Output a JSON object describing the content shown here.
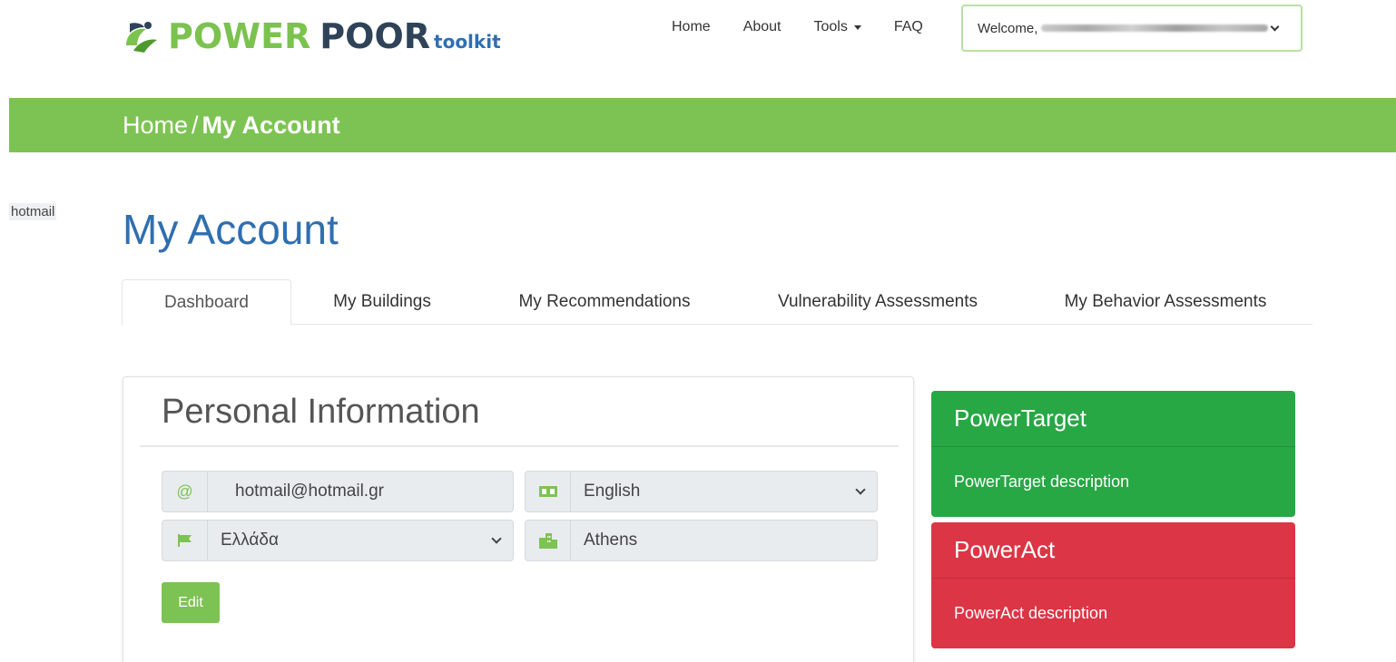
{
  "header": {
    "logo": {
      "word1": "POWER",
      "word2": "POOR",
      "word3": "toolkit"
    },
    "nav": [
      {
        "label": "Home"
      },
      {
        "label": "About"
      },
      {
        "label": "Tools"
      },
      {
        "label": "FAQ"
      }
    ],
    "welcome_label": "Welcome,"
  },
  "breadcrumb": {
    "home": "Home",
    "separator": "/",
    "current": "My Account"
  },
  "side_label": "hotmail",
  "page_title": "My Account",
  "tabs": [
    {
      "label": "Dashboard",
      "active": true
    },
    {
      "label": "My Buildings"
    },
    {
      "label": "My Recommendations"
    },
    {
      "label": "Vulnerability Assessments"
    },
    {
      "label": "My Behavior Assessments"
    }
  ],
  "personal_info": {
    "title": "Personal Information",
    "email": {
      "icon": "at-icon",
      "value": "hotmail@hotmail.gr"
    },
    "language": {
      "icon": "language-icon",
      "value": "English"
    },
    "country": {
      "icon": "flag-icon",
      "value": "Ελλάδα"
    },
    "city": {
      "icon": "city-icon",
      "value": "Athens"
    },
    "edit_label": "Edit"
  },
  "panels": [
    {
      "title": "PowerTarget",
      "description": "PowerTarget description",
      "color": "#28a745"
    },
    {
      "title": "PowerAct",
      "description": "PowerAct description",
      "color": "#dc3545"
    }
  ],
  "colors": {
    "brand_green": "#7dc353",
    "brand_blue": "#2f6fb0",
    "brand_dark": "#2f4358"
  }
}
